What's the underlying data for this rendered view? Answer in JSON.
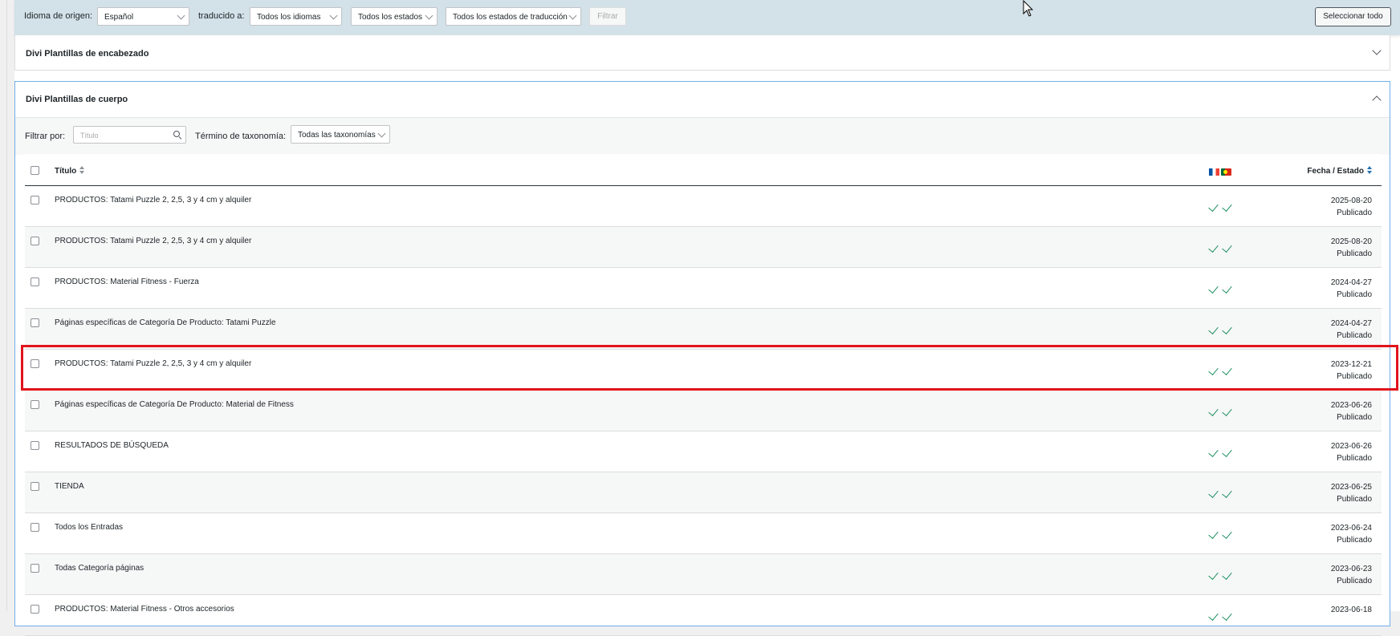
{
  "filterbar": {
    "source_lang_label": "Idioma de origen:",
    "source_lang_value": "Español",
    "translated_to_label": "traducido a:",
    "target_lang_value": "Todos los idiomas",
    "status_value": "Todos los estados",
    "translation_status_value": "Todos los estados de traducción",
    "filter_button": "Filtrar",
    "select_all_button": "Seleccionar todo"
  },
  "sections": {
    "header_templates": "Divi Plantillas de encabezado",
    "body_templates": "Divi Plantillas de cuerpo"
  },
  "subfilter": {
    "filter_by_label": "Filtrar por:",
    "title_placeholder": "Título",
    "taxonomy_label": "Término de taxonomía:",
    "taxonomy_value": "Todas las taxonomías"
  },
  "table": {
    "col_title": "Título",
    "col_date": "Fecha / Estado",
    "language_flags": [
      "fr-flag-icon",
      "pt-flag-icon"
    ],
    "rows": [
      {
        "title": "PRODUCTOS: Tatami Puzzle 2, 2,5, 3 y 4 cm y alquiler",
        "date": "2025-08-20",
        "status": "Publicado"
      },
      {
        "title": "PRODUCTOS: Tatami Puzzle 2, 2,5, 3 y 4 cm y alquiler",
        "date": "2025-08-20",
        "status": "Publicado"
      },
      {
        "title": "PRODUCTOS: Material Fitness - Fuerza",
        "date": "2024-04-27",
        "status": "Publicado"
      },
      {
        "title": "Páginas específicas de Categoría De Producto: Tatami Puzzle",
        "date": "2024-04-27",
        "status": "Publicado"
      },
      {
        "title": "PRODUCTOS: Tatami Puzzle 2, 2,5, 3 y 4 cm y alquiler",
        "date": "2023-12-21",
        "status": "Publicado"
      },
      {
        "title": "Páginas específicas de Categoría De Producto: Material de Fitness",
        "date": "2023-06-26",
        "status": "Publicado"
      },
      {
        "title": "RESULTADOS DE BÚSQUEDA",
        "date": "2023-06-26",
        "status": "Publicado"
      },
      {
        "title": "TIENDA",
        "date": "2023-06-25",
        "status": "Publicado"
      },
      {
        "title": "Todos los Entradas",
        "date": "2023-06-24",
        "status": "Publicado"
      },
      {
        "title": "Todas Categoría páginas",
        "date": "2023-06-23",
        "status": "Publicado"
      },
      {
        "title": "PRODUCTOS: Material Fitness - Otros accesorios",
        "date": "2023-06-18",
        "status": ""
      }
    ]
  },
  "colors": {
    "filterbar_bg": "#d3e1e8",
    "highlight": "#e1141c",
    "check": "#1a8e5f",
    "active_border": "#72aee6"
  }
}
